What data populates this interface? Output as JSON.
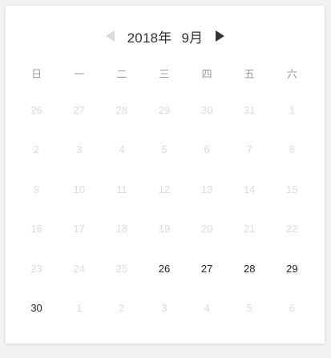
{
  "header": {
    "year_label": "2018年",
    "month_label": "9月",
    "prev_icon": "triangle-left-icon",
    "next_icon": "triangle-right-icon"
  },
  "weekdays": [
    "日",
    "一",
    "二",
    "三",
    "四",
    "五",
    "六"
  ],
  "weeks": [
    [
      {
        "d": "26",
        "a": false
      },
      {
        "d": "27",
        "a": false
      },
      {
        "d": "28",
        "a": false
      },
      {
        "d": "29",
        "a": false
      },
      {
        "d": "30",
        "a": false
      },
      {
        "d": "31",
        "a": false
      },
      {
        "d": "1",
        "a": false
      }
    ],
    [
      {
        "d": "2",
        "a": false
      },
      {
        "d": "3",
        "a": false
      },
      {
        "d": "4",
        "a": false
      },
      {
        "d": "5",
        "a": false
      },
      {
        "d": "6",
        "a": false
      },
      {
        "d": "7",
        "a": false
      },
      {
        "d": "8",
        "a": false
      }
    ],
    [
      {
        "d": "9",
        "a": false
      },
      {
        "d": "10",
        "a": false
      },
      {
        "d": "11",
        "a": false
      },
      {
        "d": "12",
        "a": false
      },
      {
        "d": "13",
        "a": false
      },
      {
        "d": "14",
        "a": false
      },
      {
        "d": "15",
        "a": false
      }
    ],
    [
      {
        "d": "16",
        "a": false
      },
      {
        "d": "17",
        "a": false
      },
      {
        "d": "18",
        "a": false
      },
      {
        "d": "19",
        "a": false
      },
      {
        "d": "20",
        "a": false
      },
      {
        "d": "21",
        "a": false
      },
      {
        "d": "22",
        "a": false
      }
    ],
    [
      {
        "d": "23",
        "a": false
      },
      {
        "d": "24",
        "a": false
      },
      {
        "d": "25",
        "a": false
      },
      {
        "d": "26",
        "a": true
      },
      {
        "d": "27",
        "a": true
      },
      {
        "d": "28",
        "a": true
      },
      {
        "d": "29",
        "a": true
      }
    ],
    [
      {
        "d": "30",
        "a": true
      },
      {
        "d": "1",
        "a": false
      },
      {
        "d": "2",
        "a": false
      },
      {
        "d": "3",
        "a": false
      },
      {
        "d": "4",
        "a": false
      },
      {
        "d": "5",
        "a": false
      },
      {
        "d": "6",
        "a": false
      }
    ]
  ],
  "colors": {
    "active_day": "#222222",
    "inactive_day": "#dcdcdc",
    "weekday": "#9b9b9b",
    "nav_disabled": "#d8d8d8",
    "nav_enabled": "#333333"
  }
}
